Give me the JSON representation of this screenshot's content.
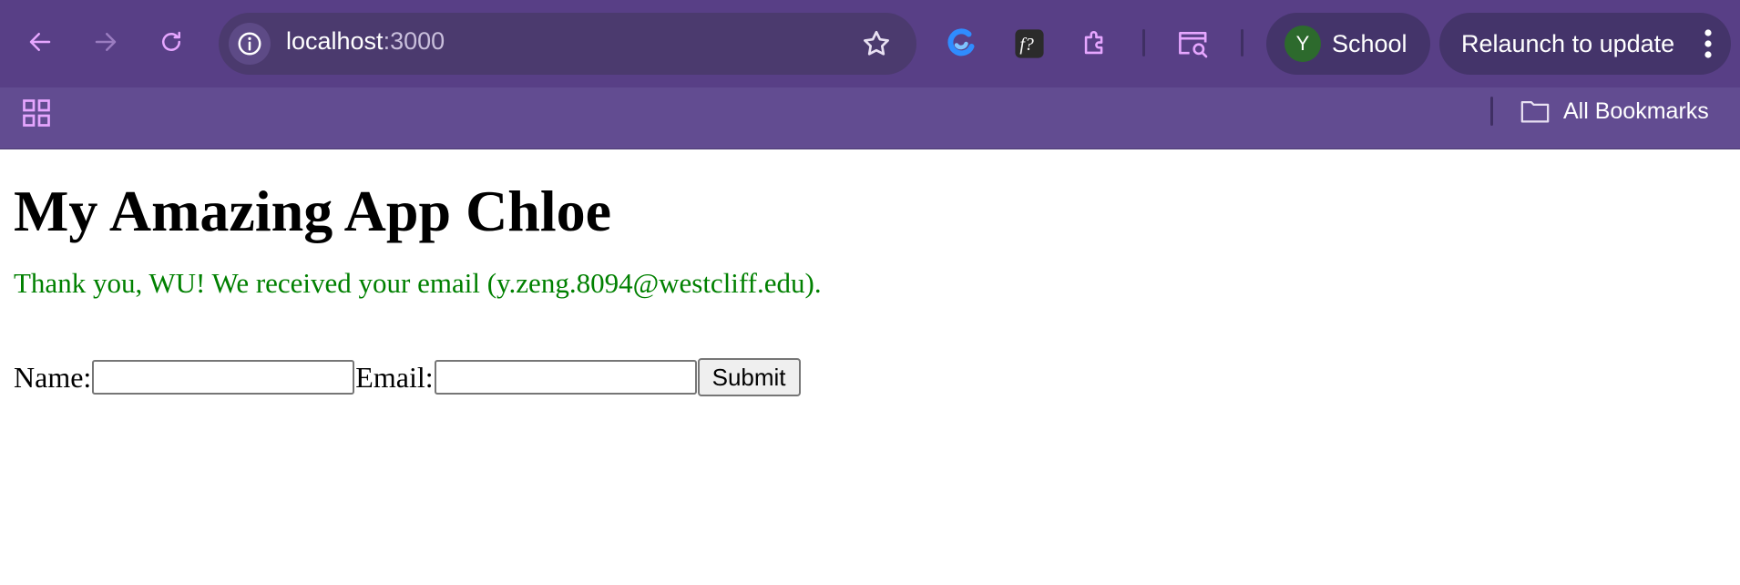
{
  "browser": {
    "url_host": "localhost",
    "url_port": ":3000",
    "profile_initial": "Y",
    "profile_name": "School",
    "relaunch_label": "Relaunch to update",
    "all_bookmarks_label": "All Bookmarks",
    "accent_color": "#583f86",
    "icons": [
      "back-icon",
      "forward-icon",
      "reload-icon",
      "site-info-icon",
      "bookmark-star-icon",
      "extension-swirl-icon",
      "extension-formula-icon",
      "extensions-puzzle-icon",
      "tab-search-icon",
      "more-menu-icon",
      "apps-grid-icon",
      "folder-icon"
    ]
  },
  "page": {
    "title": "My Amazing App Chloe",
    "confirmation": "Thank you, WU! We received your email (y.zeng.8094@westcliff.edu).",
    "confirmation_color": "#008000",
    "form": {
      "name_label": "Name:",
      "name_value": "",
      "email_label": "Email:",
      "email_value": "",
      "submit_label": "Submit"
    }
  }
}
